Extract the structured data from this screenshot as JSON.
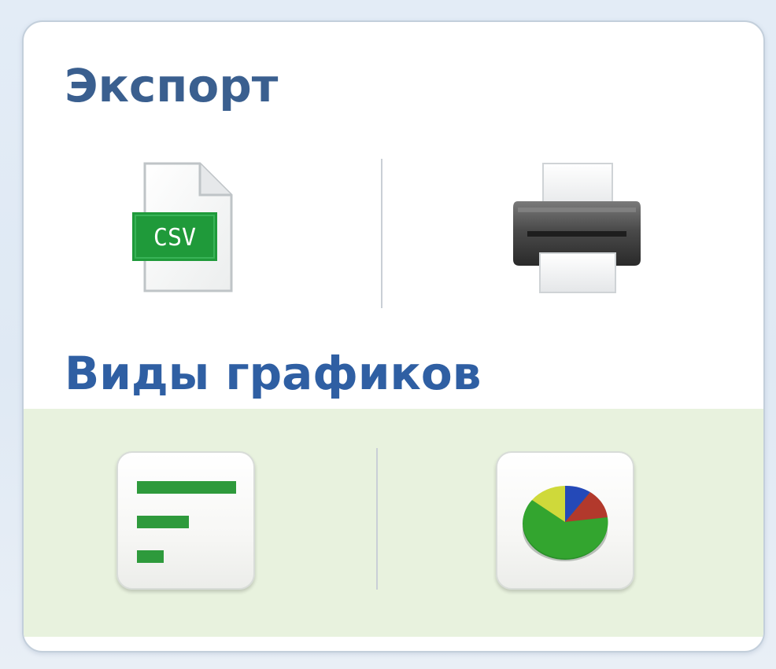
{
  "export": {
    "title": "Экспорт",
    "csv_icon_text": "CSV",
    "csv_icon": "csv-file-icon",
    "print_icon": "printer-icon"
  },
  "charts": {
    "title": "Виды графиков",
    "bar_icon": "bar-chart-icon",
    "pie_icon": "pie-chart-icon",
    "selected_bar_color": "#2e9a3c"
  },
  "colors": {
    "title": "#3a5f8f",
    "charts_bg": "#e8f2de",
    "csv_green": "#1f9a3a"
  }
}
